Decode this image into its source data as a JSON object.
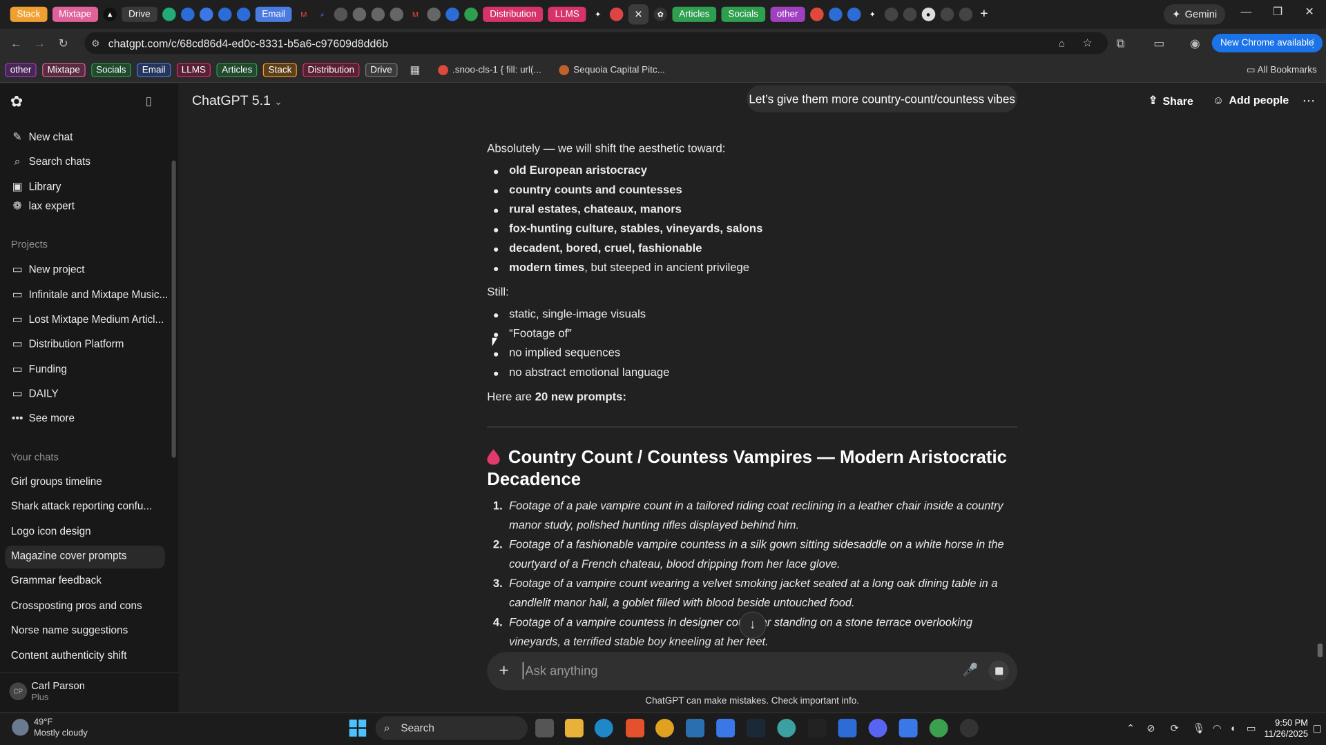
{
  "browser": {
    "tabs": [
      {
        "label": "Stack",
        "color": "#f0a030"
      },
      {
        "label": "Mixtape",
        "color": "#e0629a"
      },
      {
        "label": "Drive",
        "color": "#3a3a3a"
      },
      {
        "label": "Email",
        "color": "#4a7be0"
      },
      {
        "label": "Distribution",
        "color": "#d6336c"
      },
      {
        "label": "LLMS",
        "color": "#d6336c"
      },
      {
        "label": "Articles",
        "color": "#2e9e4f"
      },
      {
        "label": "Socials",
        "color": "#2e9e4f"
      },
      {
        "label": "other",
        "color": "#a040c0"
      }
    ],
    "gemini_label": "Gemini",
    "url": "chatgpt.com/c/68cd86d4-ed0c-8331-b5a6-c97609d8dd6b",
    "new_chrome_label": "New Chrome available",
    "bookmarks": [
      {
        "label": "other",
        "color": "#a040c0"
      },
      {
        "label": "Mixtape",
        "color": "#e0629a"
      },
      {
        "label": "Socials",
        "color": "#2e9e4f"
      },
      {
        "label": "Email",
        "color": "#4a7be0"
      },
      {
        "label": "LLMS",
        "color": "#d6336c"
      },
      {
        "label": "Articles",
        "color": "#2e9e4f"
      },
      {
        "label": "Stack",
        "color": "#f0a030"
      },
      {
        "label": "Distribution",
        "color": "#d6336c"
      },
      {
        "label": "Drive",
        "color": "#5a5a5a"
      }
    ],
    "bookmark_links": [
      ".snoo-cls-1 { fill: url(...",
      "Sequoia Capital Pitc..."
    ],
    "all_bookmarks": "All Bookmarks"
  },
  "sidebar": {
    "top": [
      {
        "label": "New chat",
        "icon": "pencil-icon"
      },
      {
        "label": "Search chats",
        "icon": "search-icon"
      },
      {
        "label": "Library",
        "icon": "library-icon"
      },
      {
        "label": "lax expert",
        "icon": "gpt-icon"
      }
    ],
    "projects_heading": "Projects",
    "projects": [
      "New project",
      "Infinitale and Mixtape Music...",
      "Lost Mixtape Medium Articl...",
      "Distribution Platform",
      "Funding",
      "DAILY",
      "See more"
    ],
    "chats_heading": "Your chats",
    "chats": [
      "Girl groups timeline",
      "Shark attack reporting confu...",
      "Logo icon design",
      "Magazine cover prompts",
      "Grammar feedback",
      "Crossposting pros and cons",
      "Norse name suggestions",
      "Content authenticity shift"
    ],
    "user_name": "Carl Parson",
    "user_plan": "Plus"
  },
  "header": {
    "model": "ChatGPT 5.1",
    "user_message": "Let’s give them more country-count/countess vibes",
    "share": "Share",
    "add_people": "Add people"
  },
  "message": {
    "intro": "Absolutely — we will shift the aesthetic toward:",
    "aesthetic": [
      {
        "bold": "old European aristocracy",
        "rest": ""
      },
      {
        "bold": "country counts and countesses",
        "rest": ""
      },
      {
        "bold": "rural estates, chateaux, manors",
        "rest": ""
      },
      {
        "bold": "fox-hunting culture, stables, vineyards, salons",
        "rest": ""
      },
      {
        "bold": "decadent, bored, cruel, fashionable",
        "rest": ""
      },
      {
        "bold": "modern times",
        "rest": ", but steeped in ancient privilege"
      }
    ],
    "still_label": "Still:",
    "still": [
      "static, single-image visuals",
      "“Footage of”",
      "no implied sequences",
      "no abstract emotional language"
    ],
    "here_pre": "Here are ",
    "here_bold": "20 new prompts:",
    "heading": "Country Count / Countess Vampires — Modern Aristocratic Decadence",
    "prompts": [
      "Footage of a pale vampire count in a tailored riding coat reclining in a leather chair inside a country manor study, polished hunting rifles displayed behind him.",
      "Footage of a fashionable vampire countess in a silk gown sitting sidesaddle on a white horse in the courtyard of a French chateau, blood dripping from her lace glove.",
      "Footage of a vampire count wearing a velvet smoking jacket seated at a long oak dining table in a candlelit manor hall, a goblet filled with blood beside untouched food.",
      "Footage of a vampire countess in designer countr    ar standing on a stone terrace overlooking vineyards, a terrified stable boy kneeling at her feet."
    ]
  },
  "composer": {
    "placeholder": "Ask anything"
  },
  "disclaimer": "ChatGPT can make mistakes. Check important info.",
  "taskbar": {
    "weather_temp": "49°F",
    "weather_desc": "Mostly cloudy",
    "search": "Search",
    "time": "9:50 PM",
    "date": "11/26/2025"
  }
}
